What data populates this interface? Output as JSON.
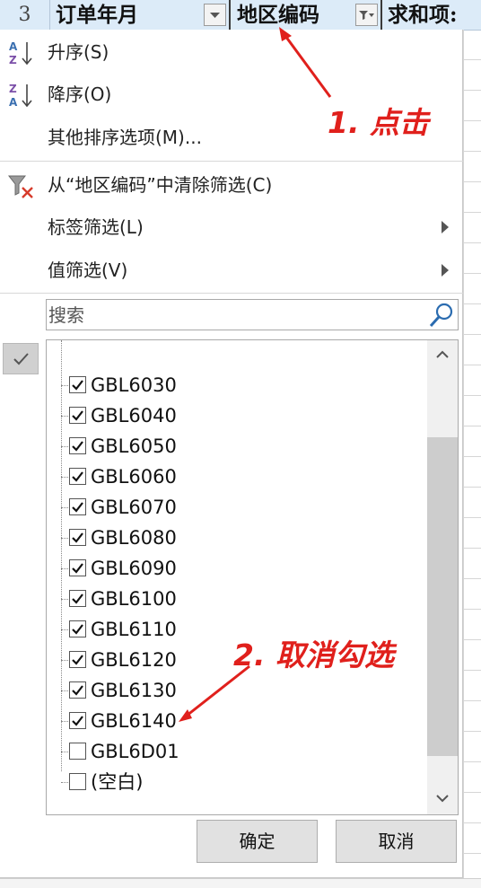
{
  "header": {
    "row_number": "3",
    "columns": [
      "订单年月",
      "地区编码",
      "求和项:"
    ]
  },
  "menu": {
    "sort_asc": "升序(S)",
    "sort_desc": "降序(O)",
    "more_sort": "其他排序选项(M)...",
    "clear_filter": "从“地区编码”中清除筛选(C)",
    "label_filter": "标签筛选(L)",
    "value_filter": "值筛选(V)"
  },
  "search": {
    "placeholder": "搜索",
    "value": ""
  },
  "list": {
    "items": [
      {
        "label": "GBL6030",
        "checked": true
      },
      {
        "label": "GBL6040",
        "checked": true
      },
      {
        "label": "GBL6050",
        "checked": true
      },
      {
        "label": "GBL6060",
        "checked": true
      },
      {
        "label": "GBL6070",
        "checked": true
      },
      {
        "label": "GBL6080",
        "checked": true
      },
      {
        "label": "GBL6090",
        "checked": true
      },
      {
        "label": "GBL6100",
        "checked": true
      },
      {
        "label": "GBL6110",
        "checked": true
      },
      {
        "label": "GBL6120",
        "checked": true
      },
      {
        "label": "GBL6130",
        "checked": true
      },
      {
        "label": "GBL6140",
        "checked": true
      },
      {
        "label": "GBL6D01",
        "checked": false
      },
      {
        "label": "(空白)",
        "checked": false
      }
    ]
  },
  "buttons": {
    "ok": "确定",
    "cancel": "取消"
  },
  "annotations": {
    "step1": "1. 点击",
    "step2": "2. 取消勾选",
    "color": "#e0201c"
  },
  "icons": {
    "sort_asc": "sort-az-icon",
    "sort_desc": "sort-za-icon",
    "clear_filter": "clear-filter-icon",
    "search": "search-icon",
    "filter_dropdown": "filter-dropdown-icon"
  }
}
